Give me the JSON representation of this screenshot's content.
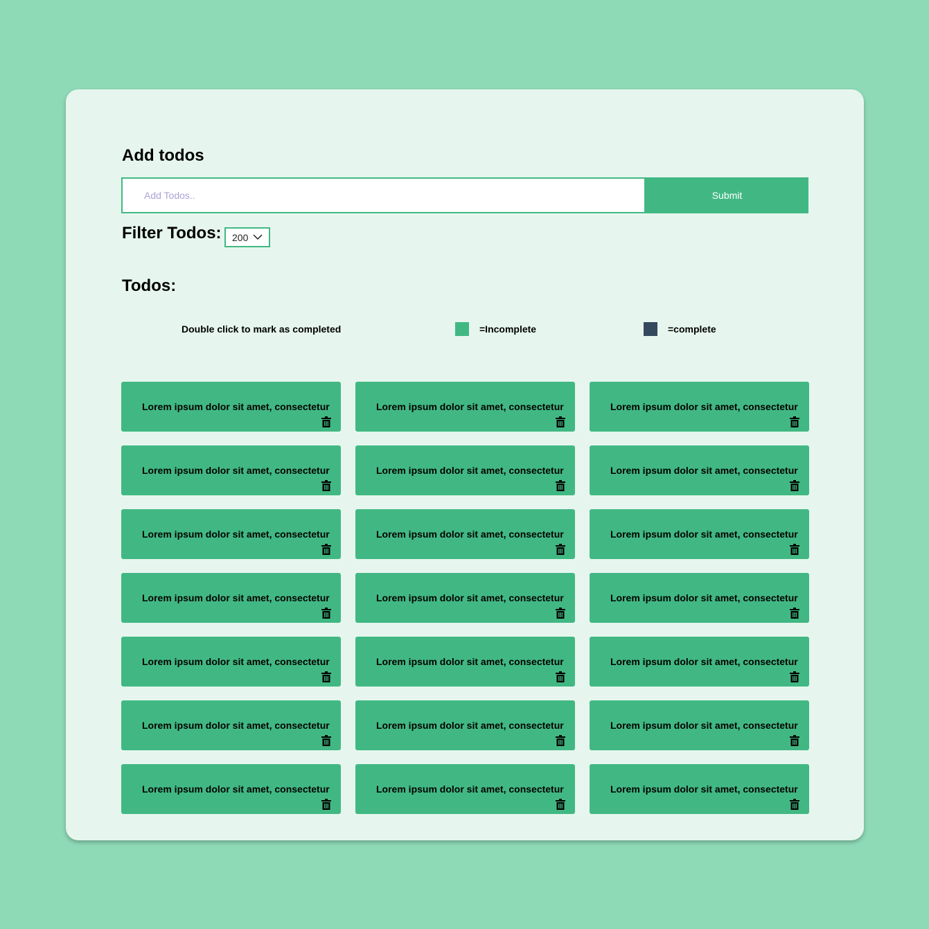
{
  "add_section": {
    "title": "Add todos",
    "input_placeholder": "Add Todos..",
    "input_value": "",
    "submit_label": "Submit"
  },
  "filter": {
    "label": "Filter Todos:",
    "selected_value": "200"
  },
  "todos_section": {
    "title": "Todos:",
    "hint": "Double click to mark as completed",
    "legend": {
      "incomplete_label": "=Incomplete",
      "complete_label": "=complete",
      "incomplete_color": "#41b883",
      "complete_color": "#34495e"
    }
  },
  "colors": {
    "page_background": "#8ed9b6",
    "card_background": "#e6f6ee",
    "accent": "#41b883"
  },
  "todos": [
    {
      "title": "Lorem ipsum dolor sit amet, consectetur",
      "completed": false,
      "icon": "trash-icon"
    },
    {
      "title": "Lorem ipsum dolor sit amet, consectetur",
      "completed": false,
      "icon": "trash-icon"
    },
    {
      "title": "Lorem ipsum dolor sit amet, consectetur",
      "completed": false,
      "icon": "trash-icon"
    },
    {
      "title": "Lorem ipsum dolor sit amet, consectetur",
      "completed": false,
      "icon": "trash-icon"
    },
    {
      "title": "Lorem ipsum dolor sit amet, consectetur",
      "completed": false,
      "icon": "trash-icon"
    },
    {
      "title": "Lorem ipsum dolor sit amet, consectetur",
      "completed": false,
      "icon": "trash-icon"
    },
    {
      "title": "Lorem ipsum dolor sit amet, consectetur",
      "completed": false,
      "icon": "trash-icon"
    },
    {
      "title": "Lorem ipsum dolor sit amet, consectetur",
      "completed": false,
      "icon": "trash-icon"
    },
    {
      "title": "Lorem ipsum dolor sit amet, consectetur",
      "completed": false,
      "icon": "trash-icon"
    },
    {
      "title": "Lorem ipsum dolor sit amet, consectetur",
      "completed": false,
      "icon": "trash-icon"
    },
    {
      "title": "Lorem ipsum dolor sit amet, consectetur",
      "completed": false,
      "icon": "trash-icon"
    },
    {
      "title": "Lorem ipsum dolor sit amet, consectetur",
      "completed": false,
      "icon": "trash-icon"
    },
    {
      "title": "Lorem ipsum dolor sit amet, consectetur",
      "completed": false,
      "icon": "trash-icon"
    },
    {
      "title": "Lorem ipsum dolor sit amet, consectetur",
      "completed": false,
      "icon": "trash-icon"
    },
    {
      "title": "Lorem ipsum dolor sit amet, consectetur",
      "completed": false,
      "icon": "trash-icon"
    },
    {
      "title": "Lorem ipsum dolor sit amet, consectetur",
      "completed": false,
      "icon": "trash-icon"
    },
    {
      "title": "Lorem ipsum dolor sit amet, consectetur",
      "completed": false,
      "icon": "trash-icon"
    },
    {
      "title": "Lorem ipsum dolor sit amet, consectetur",
      "completed": false,
      "icon": "trash-icon"
    },
    {
      "title": "Lorem ipsum dolor sit amet, consectetur",
      "completed": false,
      "icon": "trash-icon"
    },
    {
      "title": "Lorem ipsum dolor sit amet, consectetur",
      "completed": false,
      "icon": "trash-icon"
    },
    {
      "title": "Lorem ipsum dolor sit amet, consectetur",
      "completed": false,
      "icon": "trash-icon"
    }
  ]
}
